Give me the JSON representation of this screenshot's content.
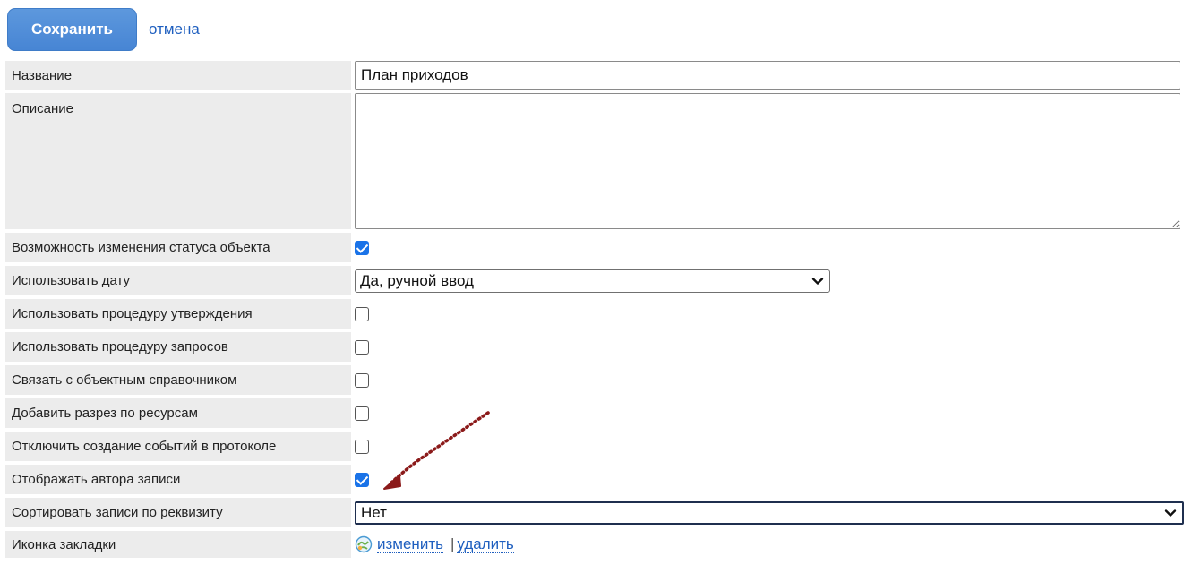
{
  "toolbar": {
    "save_label": "Сохранить",
    "cancel_label": "отмена"
  },
  "fields": {
    "name": {
      "label": "Название",
      "value": "План приходов"
    },
    "description": {
      "label": "Описание",
      "value": ""
    },
    "status_change": {
      "label": "Возможность изменения статуса объекта",
      "checked": true
    },
    "use_date": {
      "label": "Использовать дату",
      "value": "Да, ручной ввод"
    },
    "approval": {
      "label": "Использовать процедуру утверждения",
      "checked": false
    },
    "requests": {
      "label": "Использовать процедуру запросов",
      "checked": false
    },
    "object_reference": {
      "label": "Связать с объектным справочником",
      "checked": false
    },
    "resources": {
      "label": "Добавить разрез по ресурсам",
      "checked": false
    },
    "disable_events": {
      "label": "Отключить создание событий в протоколе",
      "checked": false
    },
    "show_author": {
      "label": "Отображать автора записи",
      "checked": true
    },
    "sort_by": {
      "label": "Сортировать записи по реквизиту",
      "value": "Нет"
    },
    "bookmark_icon": {
      "label": "Иконка закладки",
      "change_label": "изменить",
      "separator": "|",
      "delete_label": "удалить"
    }
  },
  "colors": {
    "accent": "#4a88d6",
    "link": "#1f5fbf",
    "label_bg": "#ececec",
    "checkbox_checked": "#1a73e8",
    "annotation_arrow": "#8b1a1a"
  }
}
